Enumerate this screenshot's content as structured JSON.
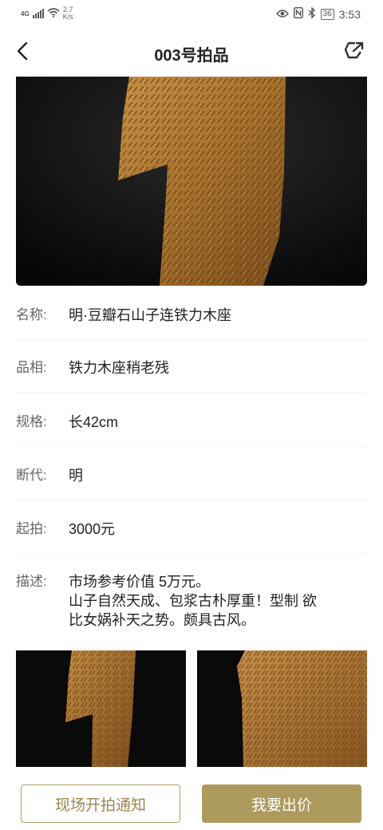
{
  "status_bar": {
    "network": "4G",
    "speed_value": "2.7",
    "speed_unit": "K/s",
    "battery": "36",
    "time": "3:53",
    "icons": [
      "eye-icon",
      "nfc-icon",
      "bluetooth-icon"
    ]
  },
  "header": {
    "title": "003号拍品",
    "back_icon": "chevron-left-icon",
    "share_icon": "share-icon"
  },
  "details": {
    "name": {
      "label": "名称:",
      "value": "明·豆瓣石山子连铁力木座"
    },
    "condition": {
      "label": "品相:",
      "value": "铁力木座稍老残"
    },
    "size": {
      "label": "规格:",
      "value": "长42cm"
    },
    "era": {
      "label": "断代:",
      "value": "明"
    },
    "start_price": {
      "label": "起拍:",
      "value": "3000元"
    },
    "description": {
      "label": "描述:",
      "lines": [
        "市场参考价值 5万元。",
        "山子自然天成、包浆古朴厚重！型制 欲",
        "比女娲补天之势。颇具古风。"
      ]
    }
  },
  "bottom_bar": {
    "notify_label": "现场开拍通知",
    "bid_label": "我要出价"
  },
  "colors": {
    "accent_gold": "#ad9a5d",
    "outline_gold": "#b09e66",
    "image_bg": "#0b0b0b",
    "stone": "#b07c35"
  }
}
